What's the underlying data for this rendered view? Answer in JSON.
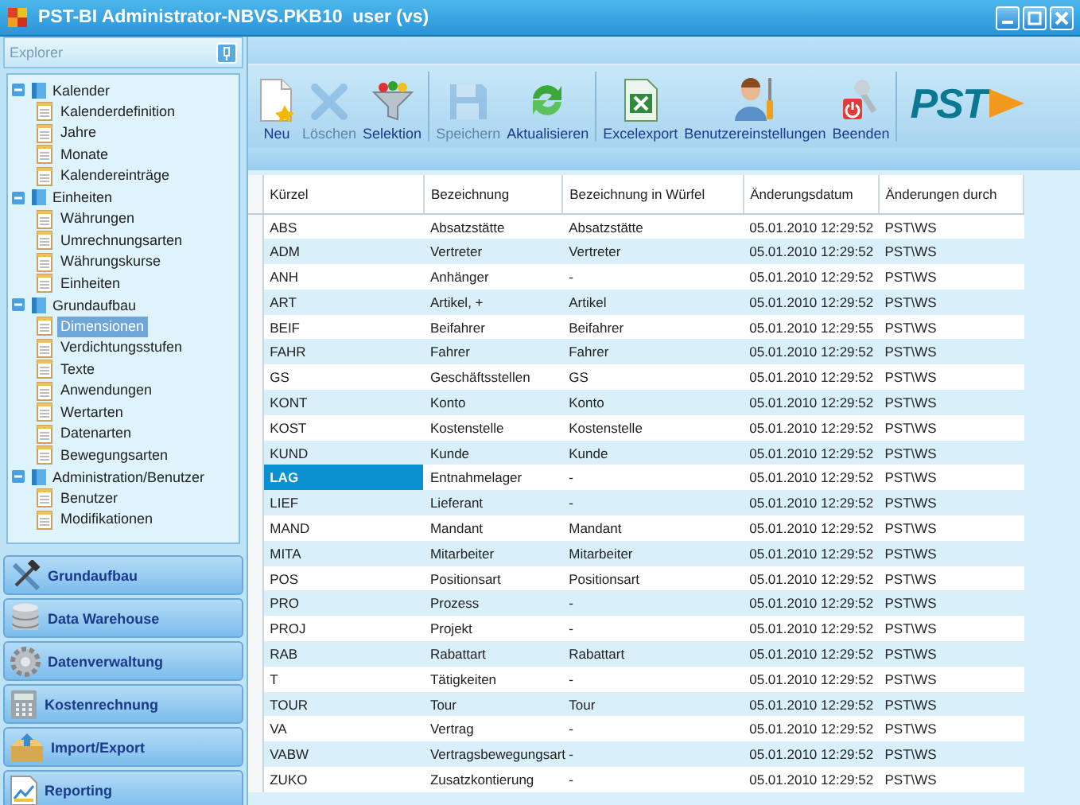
{
  "window": {
    "title": "PST-BI Administrator-NBVS.PKB10  user (vs)"
  },
  "explorer": {
    "title": "Explorer",
    "tree": [
      {
        "label": "Kalender",
        "expanded": true,
        "children": [
          {
            "label": "Kalenderdefinition",
            "selected": false
          },
          {
            "label": "Jahre",
            "selected": false
          },
          {
            "label": "Monate",
            "selected": false
          },
          {
            "label": "Kalendereinträge",
            "selected": false
          }
        ]
      },
      {
        "label": "Einheiten",
        "expanded": true,
        "children": [
          {
            "label": "Währungen",
            "selected": false
          },
          {
            "label": "Umrechnungsarten",
            "selected": false
          },
          {
            "label": "Währungskurse",
            "selected": false
          },
          {
            "label": "Einheiten",
            "selected": false
          }
        ]
      },
      {
        "label": "Grundaufbau",
        "expanded": true,
        "children": [
          {
            "label": "Dimensionen",
            "selected": true
          },
          {
            "label": "Verdichtungsstufen",
            "selected": false
          },
          {
            "label": "Texte",
            "selected": false
          },
          {
            "label": "Anwendungen",
            "selected": false
          },
          {
            "label": "Wertarten",
            "selected": false
          },
          {
            "label": "Datenarten",
            "selected": false
          },
          {
            "label": "Bewegungsarten",
            "selected": false
          }
        ]
      },
      {
        "label": "Administration/Benutzer",
        "expanded": true,
        "children": [
          {
            "label": "Benutzer",
            "selected": false
          },
          {
            "label": "Modifikationen",
            "selected": false
          }
        ]
      }
    ]
  },
  "nav": [
    {
      "label": "Grundaufbau",
      "kind": "tools"
    },
    {
      "label": "Data Warehouse",
      "kind": "database"
    },
    {
      "label": "Datenverwaltung",
      "kind": "gear"
    },
    {
      "label": "Kostenrechnung",
      "kind": "calculator"
    },
    {
      "label": "Import/Export",
      "kind": "box"
    },
    {
      "label": "Reporting",
      "kind": "report"
    }
  ],
  "toolbar": {
    "groups": [
      {
        "buttons": [
          {
            "label": "Neu",
            "kind": "new",
            "disabled": false
          },
          {
            "label": "Löschen",
            "kind": "delete",
            "disabled": true
          },
          {
            "label": "Selektion",
            "kind": "filter",
            "disabled": false
          }
        ]
      },
      {
        "buttons": [
          {
            "label": "Speichern",
            "kind": "save",
            "disabled": true
          },
          {
            "label": "Aktualisieren",
            "kind": "refresh",
            "disabled": false
          }
        ]
      },
      {
        "buttons": [
          {
            "label": "Excelexport",
            "kind": "excel",
            "disabled": false
          },
          {
            "label": "Benutzereinstellungen",
            "kind": "user",
            "disabled": false
          },
          {
            "label": "Beenden",
            "kind": "exit",
            "disabled": false
          }
        ]
      }
    ],
    "logo": "PST"
  },
  "table": {
    "columns": [
      "Kürzel",
      "Bezeichnung",
      "Bezeichnung in Würfel",
      "Änderungsdatum",
      "Änderungen durch"
    ],
    "rows": [
      {
        "cells": [
          "ABS",
          "Absatzstätte",
          "Absatzstätte",
          "05.01.2010 12:29:52",
          "PST\\WS"
        ],
        "selected": false
      },
      {
        "cells": [
          "ADM",
          "Vertreter",
          "Vertreter",
          "05.01.2010 12:29:52",
          "PST\\WS"
        ],
        "selected": false
      },
      {
        "cells": [
          "ANH",
          "Anhänger",
          "-",
          "05.01.2010 12:29:52",
          "PST\\WS"
        ],
        "selected": false
      },
      {
        "cells": [
          "ART",
          "Artikel, +",
          "Artikel",
          "05.01.2010 12:29:52",
          "PST\\WS"
        ],
        "selected": false
      },
      {
        "cells": [
          "BEIF",
          "Beifahrer",
          "Beifahrer",
          "05.01.2010 12:29:55",
          "PST\\WS"
        ],
        "selected": false
      },
      {
        "cells": [
          "FAHR",
          "Fahrer",
          "Fahrer",
          "05.01.2010 12:29:52",
          "PST\\WS"
        ],
        "selected": false
      },
      {
        "cells": [
          "GS",
          "Geschäftsstellen",
          "GS",
          "05.01.2010 12:29:52",
          "PST\\WS"
        ],
        "selected": false
      },
      {
        "cells": [
          "KONT",
          "Konto",
          "Konto",
          "05.01.2010 12:29:52",
          "PST\\WS"
        ],
        "selected": false
      },
      {
        "cells": [
          "KOST",
          "Kostenstelle",
          "Kostenstelle",
          "05.01.2010 12:29:52",
          "PST\\WS"
        ],
        "selected": false
      },
      {
        "cells": [
          "KUND",
          "Kunde",
          "Kunde",
          "05.01.2010 12:29:52",
          "PST\\WS"
        ],
        "selected": false
      },
      {
        "cells": [
          "LAG",
          "Entnahmelager",
          "-",
          "05.01.2010 12:29:52",
          "PST\\WS"
        ],
        "selected": true
      },
      {
        "cells": [
          "LIEF",
          "Lieferant",
          "-",
          "05.01.2010 12:29:52",
          "PST\\WS"
        ],
        "selected": false
      },
      {
        "cells": [
          "MAND",
          "Mandant",
          "Mandant",
          "05.01.2010 12:29:52",
          "PST\\WS"
        ],
        "selected": false
      },
      {
        "cells": [
          "MITA",
          "Mitarbeiter",
          "Mitarbeiter",
          "05.01.2010 12:29:52",
          "PST\\WS"
        ],
        "selected": false
      },
      {
        "cells": [
          "POS",
          "Positionsart",
          "Positionsart",
          "05.01.2010 12:29:52",
          "PST\\WS"
        ],
        "selected": false
      },
      {
        "cells": [
          "PRO",
          "Prozess",
          "-",
          "05.01.2010 12:29:52",
          "PST\\WS"
        ],
        "selected": false
      },
      {
        "cells": [
          "PROJ",
          "Projekt",
          "-",
          "05.01.2010 12:29:52",
          "PST\\WS"
        ],
        "selected": false
      },
      {
        "cells": [
          "RAB",
          "Rabattart",
          "Rabattart",
          "05.01.2010 12:29:52",
          "PST\\WS"
        ],
        "selected": false
      },
      {
        "cells": [
          "T",
          "Tätigkeiten",
          "-",
          "05.01.2010 12:29:52",
          "PST\\WS"
        ],
        "selected": false
      },
      {
        "cells": [
          "TOUR",
          "Tour",
          "Tour",
          "05.01.2010 12:29:52",
          "PST\\WS"
        ],
        "selected": false
      },
      {
        "cells": [
          "VA",
          "Vertrag",
          "-",
          "05.01.2010 12:29:52",
          "PST\\WS"
        ],
        "selected": false
      },
      {
        "cells": [
          "VABW",
          "Vertragsbewegungsart",
          "-",
          "05.01.2010 12:29:52",
          "PST\\WS"
        ],
        "selected": false
      },
      {
        "cells": [
          "ZUKO",
          "Zusatzkontierung",
          "-",
          "05.01.2010 12:29:52",
          "PST\\WS"
        ],
        "selected": false
      }
    ]
  }
}
